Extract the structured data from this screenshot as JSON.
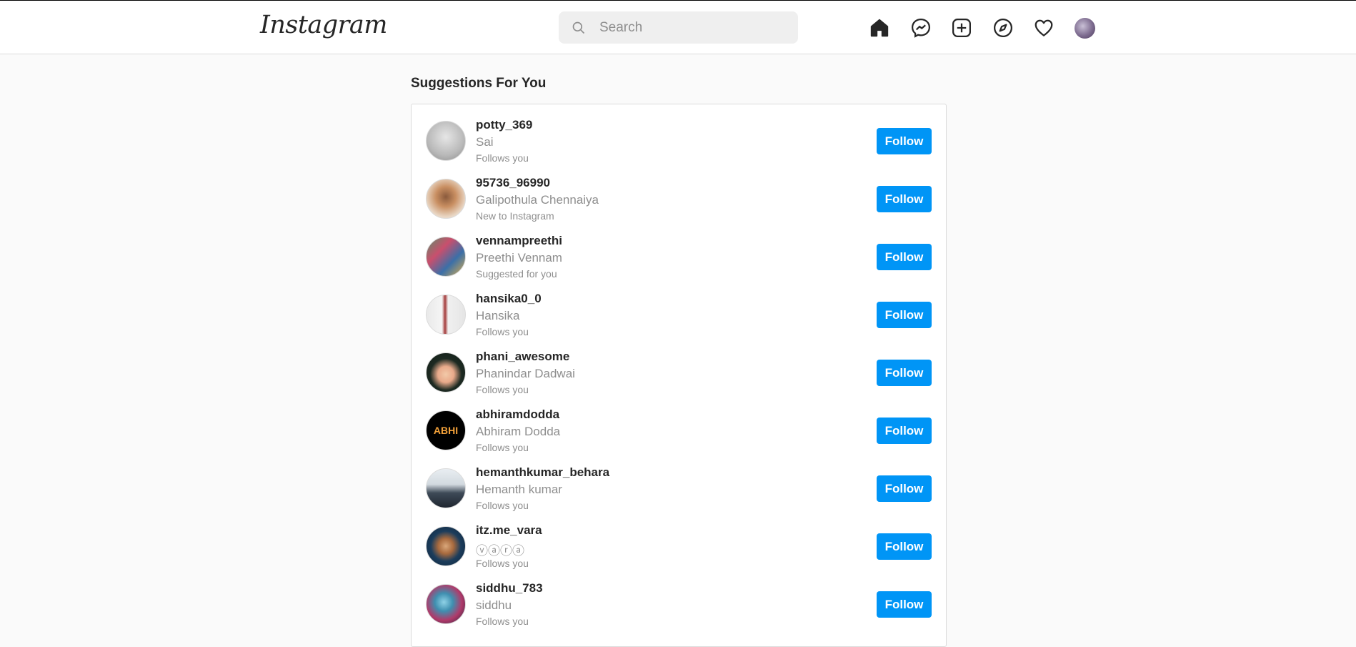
{
  "header": {
    "logo": "Instagram",
    "search_placeholder": "Search",
    "icons": [
      "home-icon",
      "messenger-icon",
      "new-post-icon",
      "explore-icon",
      "activity-heart-icon",
      "profile-avatar"
    ]
  },
  "page": {
    "heading": "Suggestions For You"
  },
  "suggestions": [
    {
      "username": "potty_369",
      "name": "Sai",
      "reason": "Follows you",
      "button": "Follow"
    },
    {
      "username": "95736_96990",
      "name": "Galipothula Chennaiya",
      "reason": "New to Instagram",
      "button": "Follow"
    },
    {
      "username": "vennampreethi",
      "name": "Preethi Vennam",
      "reason": "Suggested for you",
      "button": "Follow"
    },
    {
      "username": "hansika0_0",
      "name": "Hansika",
      "reason": "Follows you",
      "button": "Follow"
    },
    {
      "username": "phani_awesome",
      "name": "Phanindar Dadwai",
      "reason": "Follows you",
      "button": "Follow"
    },
    {
      "username": "abhiramdodda",
      "name": "Abhiram Dodda",
      "reason": "Follows you",
      "button": "Follow"
    },
    {
      "username": "hemanthkumar_behara",
      "name": "Hemanth kumar",
      "reason": "Follows you",
      "button": "Follow"
    },
    {
      "username": "itz.me_vara",
      "name": "ⓥⓐⓡⓐ",
      "reason": "Follows you",
      "button": "Follow"
    },
    {
      "username": "siddhu_783",
      "name": "siddhu",
      "reason": "Follows you",
      "button": "Follow"
    }
  ],
  "colors": {
    "primary_button": "#0095f6",
    "secondary_text": "#8e8e8e",
    "background": "#fafafa"
  }
}
